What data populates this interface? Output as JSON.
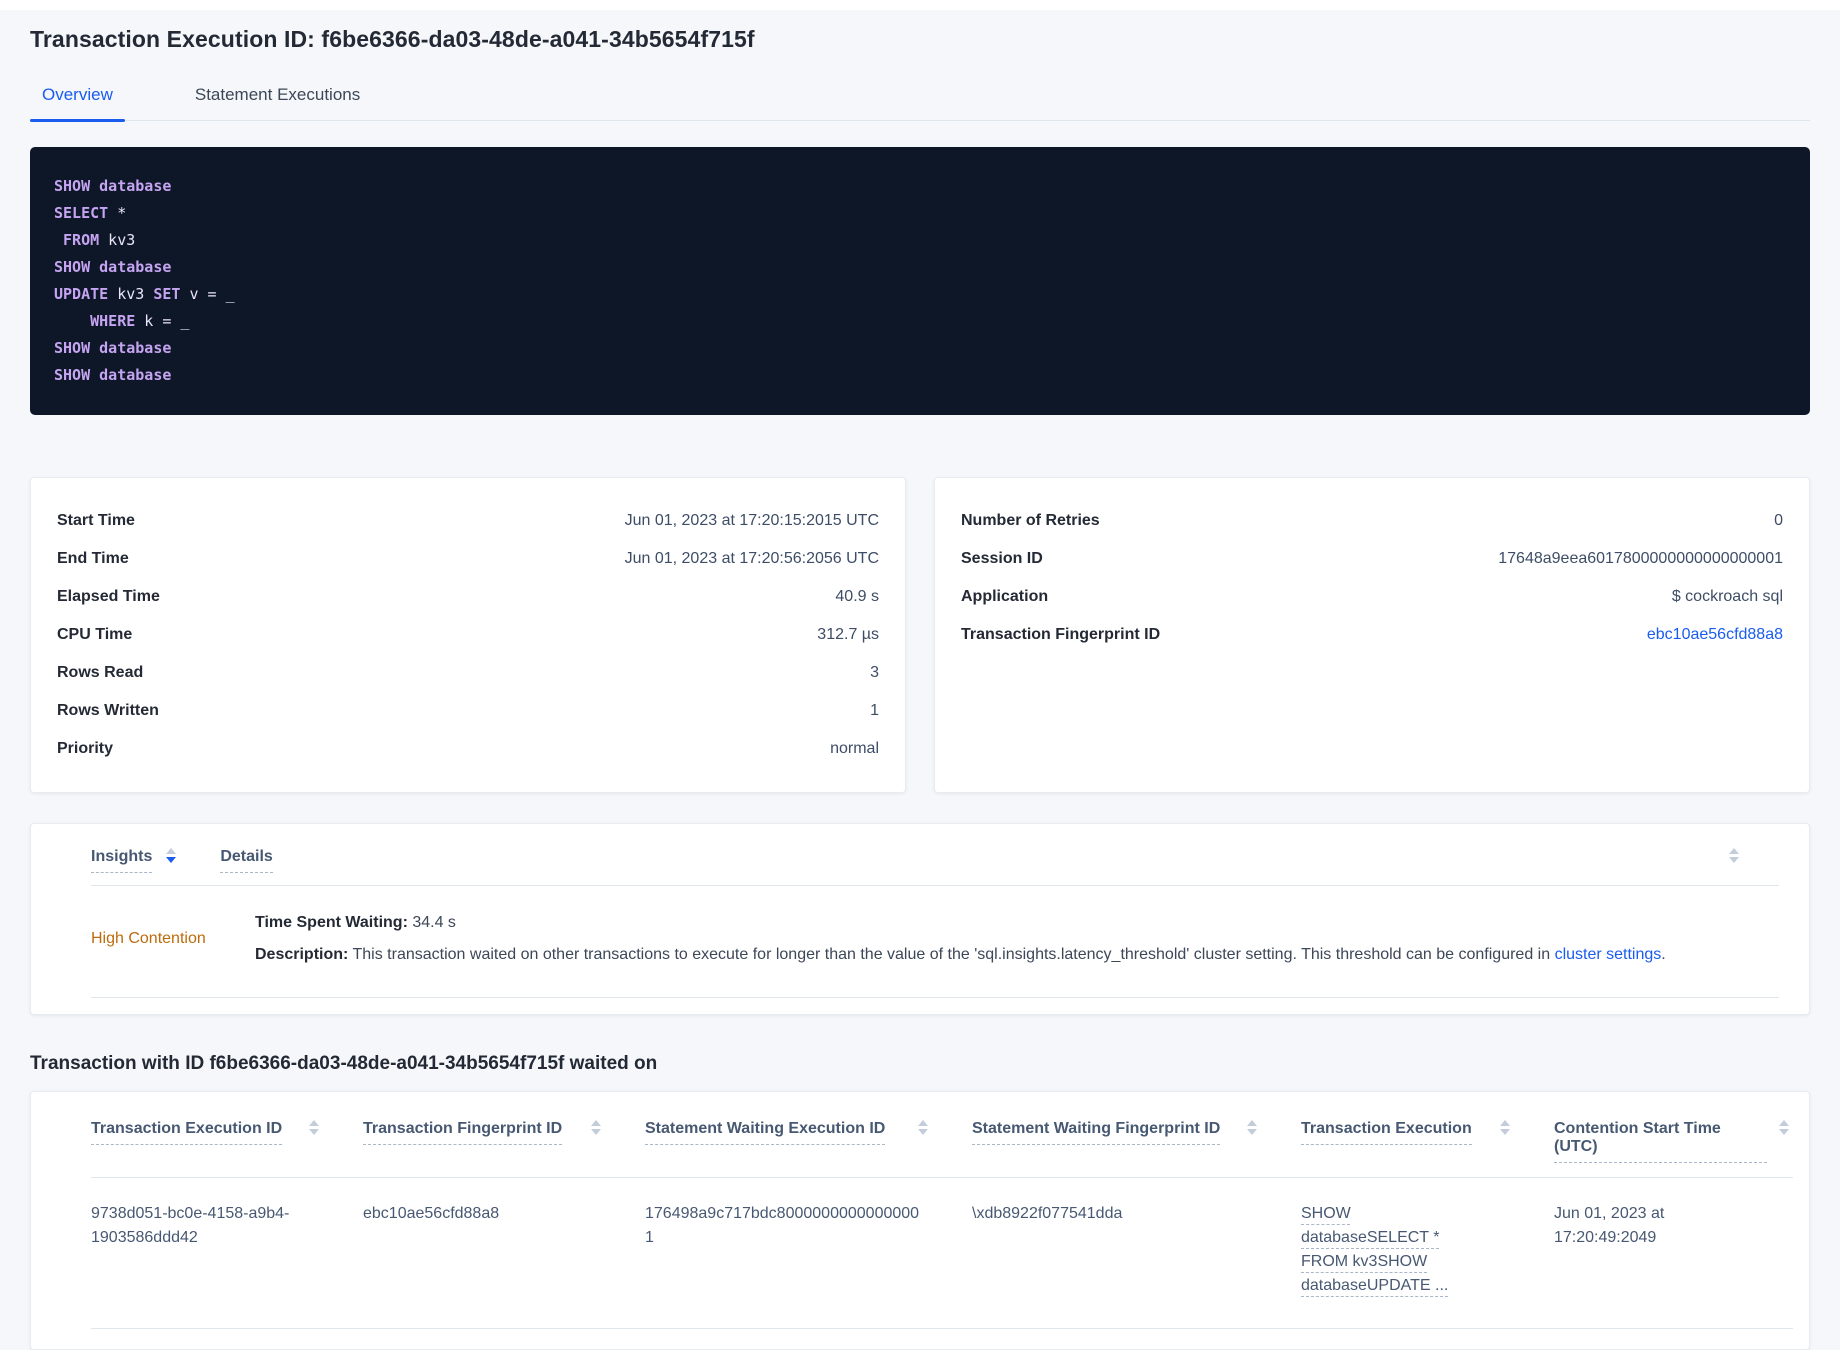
{
  "page": {
    "title": "Transaction Execution ID: f6be6366-da03-48de-a041-34b5654f715f"
  },
  "tabs": [
    {
      "label": "Overview",
      "active": true
    },
    {
      "label": "Statement Executions",
      "active": false
    }
  ],
  "sql": {
    "lines": [
      [
        {
          "t": "SHOW",
          "k": 1
        },
        {
          "t": " "
        },
        {
          "t": "database",
          "k": 1
        }
      ],
      [
        {
          "t": "SELECT",
          "k": 1
        },
        {
          "t": " *"
        }
      ],
      [
        {
          "t": " "
        },
        {
          "t": "FROM",
          "k": 1
        },
        {
          "t": " kv3"
        }
      ],
      [
        {
          "t": "SHOW",
          "k": 1
        },
        {
          "t": " "
        },
        {
          "t": "database",
          "k": 1
        }
      ],
      [
        {
          "t": "UPDATE",
          "k": 1
        },
        {
          "t": " kv3 "
        },
        {
          "t": "SET",
          "k": 1
        },
        {
          "t": " v = _"
        }
      ],
      [
        {
          "t": "    "
        },
        {
          "t": "WHERE",
          "k": 1
        },
        {
          "t": " k = _"
        }
      ],
      [
        {
          "t": "SHOW",
          "k": 1
        },
        {
          "t": " "
        },
        {
          "t": "database",
          "k": 1
        }
      ],
      [
        {
          "t": "SHOW",
          "k": 1
        },
        {
          "t": " "
        },
        {
          "t": "database",
          "k": 1
        }
      ]
    ]
  },
  "details_left": {
    "rows": [
      {
        "label": "Start Time",
        "value": "Jun 01, 2023 at 17:20:15:2015 UTC"
      },
      {
        "label": "End Time",
        "value": "Jun 01, 2023 at 17:20:56:2056 UTC"
      },
      {
        "label": "Elapsed Time",
        "value": "40.9 s"
      },
      {
        "label": "CPU Time",
        "value": "312.7 µs"
      },
      {
        "label": "Rows Read",
        "value": "3"
      },
      {
        "label": "Rows Written",
        "value": "1"
      },
      {
        "label": "Priority",
        "value": "normal"
      }
    ]
  },
  "details_right": {
    "rows": [
      {
        "label": "Number of Retries",
        "value": "0"
      },
      {
        "label": "Session ID",
        "value": "17648a9eea6017800000000000000001"
      },
      {
        "label": "Application",
        "value": "$ cockroach sql"
      },
      {
        "label": "Transaction Fingerprint ID",
        "value": "ebc10ae56cfd88a8",
        "link": true
      }
    ]
  },
  "insights": {
    "col_insights": "Insights",
    "col_details": "Details",
    "row": {
      "insight": "High Contention",
      "waiting_label": "Time Spent Waiting:",
      "waiting_value": " 34.4 s",
      "desc_label": "Description:",
      "desc_text": " This transaction waited on other transactions to execute for longer than the value of the 'sql.insights.latency_threshold' cluster setting. This threshold can be configured in ",
      "desc_link": "cluster settings",
      "desc_end": "."
    }
  },
  "waited": {
    "heading": "Transaction with ID f6be6366-da03-48de-a041-34b5654f715f waited on",
    "columns": [
      "Transaction Execution ID",
      "Transaction Fingerprint ID",
      "Statement Waiting Execution ID",
      "Statement Waiting Fingerprint ID",
      "Transaction Execution",
      "Contention Start Time (UTC)"
    ],
    "row": {
      "txn_execution_id": "9738d051-bc0e-4158-a9b4-1903586ddd42",
      "txn_fingerprint_id": "ebc10ae56cfd88a8",
      "stmt_waiting_execution_id": "176498a9c717bdc80000000000000001",
      "stmt_waiting_fingerprint_id": "\\xdb8922f077541dda",
      "txn_execution": "SHOW databaseSELECT * FROM kv3SHOW databaseUPDATE ...",
      "contention_start": "Jun 01, 2023 at 17:20:49:2049"
    }
  },
  "colors": {
    "accent_blue": "#1a5cf0",
    "insight_orange": "#bd6b0d",
    "sql_keyword": "#c5a4f2",
    "sql_background": "#0e1728"
  }
}
